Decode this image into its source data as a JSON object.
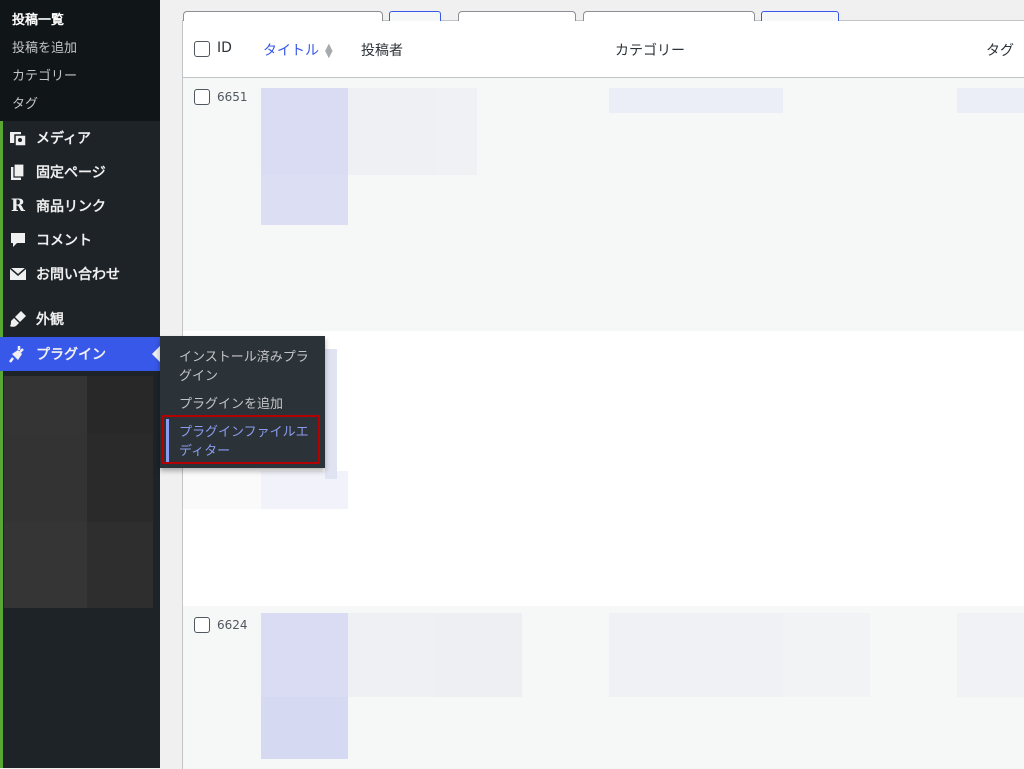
{
  "sidebar": {
    "posts_submenu": [
      "投稿一覧",
      "投稿を追加",
      "カテゴリー",
      "タグ"
    ],
    "menu": [
      {
        "label": "メディア",
        "icon": "media-icon"
      },
      {
        "label": "固定ページ",
        "icon": "pages-icon"
      },
      {
        "label": "商品リンク",
        "icon": "rakuten-icon"
      },
      {
        "label": "コメント",
        "icon": "comment-icon"
      },
      {
        "label": "お問い合わせ",
        "icon": "mail-icon"
      },
      {
        "label": "外観",
        "icon": "paintbrush-icon"
      },
      {
        "label": "プラグイン",
        "icon": "plugin-icon"
      }
    ]
  },
  "flyout": {
    "items": [
      "インストール済みプラグイン",
      "プラグインを追加",
      "プラグインファイルエディター"
    ]
  },
  "table": {
    "columns": {
      "id": "ID",
      "title": "タイトル",
      "author": "投稿者",
      "category": "カテゴリー",
      "tag": "タグ"
    },
    "rows": [
      {
        "id": "6651"
      },
      {
        "id": ""
      },
      {
        "id": "6624"
      }
    ]
  },
  "colors": {
    "sidebar_bg": "#1d2327",
    "accent": "#3858e9",
    "highlight_border": "#b30000"
  }
}
